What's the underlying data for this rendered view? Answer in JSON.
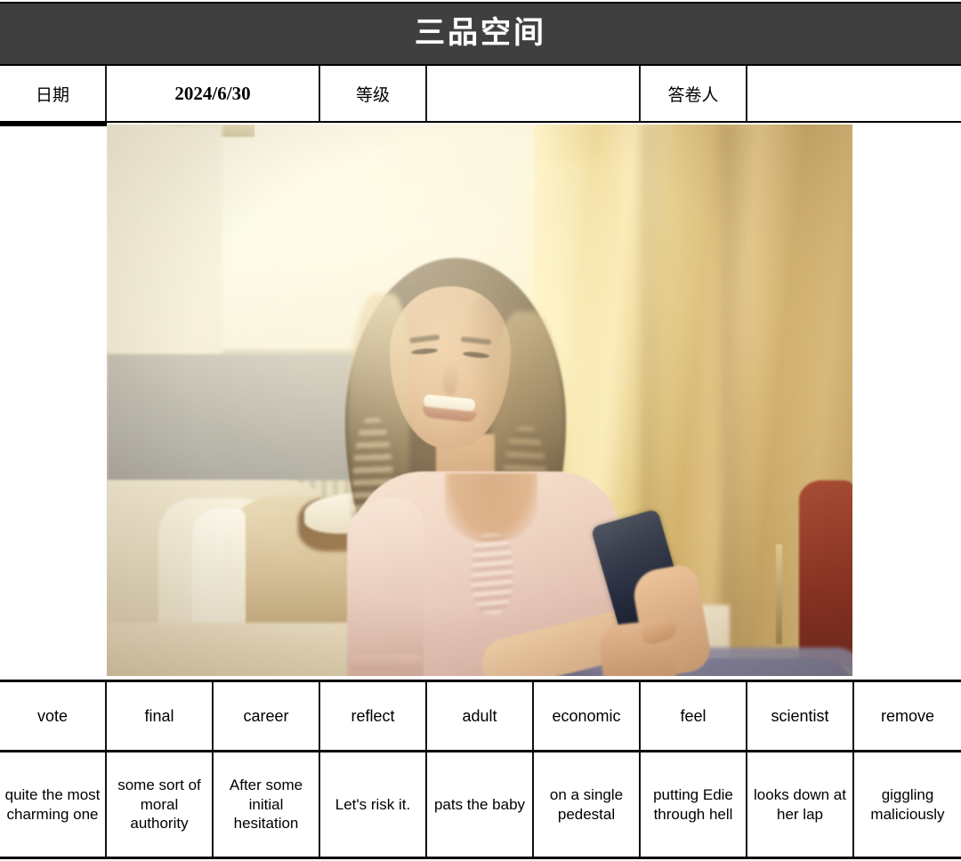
{
  "header": {
    "title": "三品空间",
    "title_bar_color": "#3f3f3f",
    "title_text_color": "#ffffff"
  },
  "meta_row": {
    "date_label": "日期",
    "date_value": "2024/6/30",
    "level_label": "等级",
    "level_value": "",
    "respondent_label": "答卷人",
    "respondent_value": ""
  },
  "photo": {
    "alt": "Smiling young woman with long curly hair sitting on a sofa by a sunlit window, looking down at her smartphone",
    "caption": ""
  },
  "word_row": {
    "words": [
      "vote",
      "final",
      "career",
      "reflect",
      "adult",
      "economic",
      "feel",
      "scientist",
      "remove"
    ]
  },
  "phrase_row": {
    "phrases": [
      "quite the most charming one",
      "some sort of moral authority",
      "After some initial hesitation",
      "Let's risk it.",
      "pats the baby",
      "on a single pedestal",
      "putting Edie through hell",
      "looks down at her lap",
      "giggling maliciously"
    ]
  }
}
